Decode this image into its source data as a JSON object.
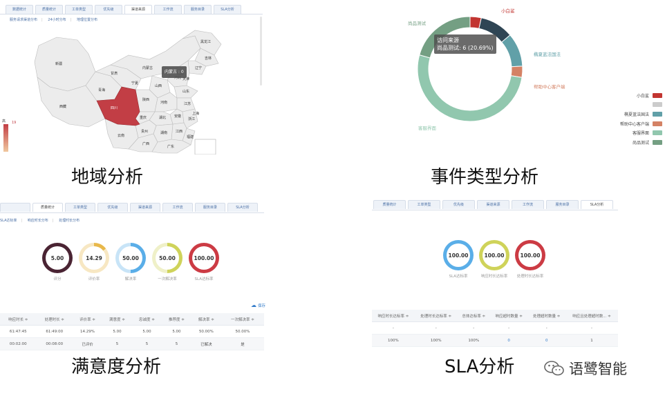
{
  "panel_region": {
    "tabs": [
      "数据统计",
      "质量统计",
      "工单类型",
      "优先级",
      "渠道来源",
      "工作流",
      "服务目录",
      "SLA分析"
    ],
    "active_tab": 4,
    "subnav": [
      "服务请求渠道分布",
      "24小时分布",
      "地理位置分布"
    ],
    "map_tooltip": "内蒙古 : 0",
    "legend_high": "高",
    "legend_high_value": "19",
    "provinces": [
      "新疆",
      "西藏",
      "青海",
      "甘肃",
      "四川",
      "内蒙古",
      "宁夏",
      "山西",
      "河北",
      "北京",
      "天津",
      "辽宁",
      "吉林",
      "黑龙江",
      "陕西",
      "河南",
      "山东",
      "江苏",
      "安徽",
      "湖北",
      "重庆",
      "贵州",
      "湖南",
      "江西",
      "浙江",
      "福建",
      "云南",
      "广西",
      "广东",
      "上海"
    ],
    "caption": "地域分析"
  },
  "panel_event": {
    "tooltip_title": "访问来源",
    "tooltip_value": "尚品测试: 6 (20.69%)",
    "chart_data": {
      "type": "pie",
      "donut": true,
      "series": [
        {
          "name": "小白鲨",
          "value": 1,
          "color": "#c23531"
        },
        {
          "name": "",
          "value": 3,
          "color": "#2f4554"
        },
        {
          "name": "椭夏蓝法国法",
          "value": 3,
          "color": "#61a0a8"
        },
        {
          "name": "帮助中心客户端",
          "value": 1,
          "color": "#d48265"
        },
        {
          "name": "客服界面",
          "value": 15,
          "color": "#91c7ae"
        },
        {
          "name": "尚品测试",
          "value": 6,
          "color": "#749f83"
        }
      ],
      "legend_position": "right"
    },
    "caption": "事件类型分析"
  },
  "panel_satisfaction": {
    "tabs": [
      "",
      "质量统计",
      "工单类型",
      "优先级",
      "渠道来源",
      "工作流",
      "服务目录",
      "SLA分析"
    ],
    "active_tab": 1,
    "subnav": [
      "SLA达标率",
      "响应时长分布",
      "处理时长分布"
    ],
    "rings": [
      {
        "value": "5.00",
        "label": "评分",
        "color": "#4a2433",
        "fill": 1.0
      },
      {
        "value": "14.29",
        "label": "评价率",
        "color": "#e8b84a",
        "fill": 0.1429
      },
      {
        "value": "50.00",
        "label": "解决率",
        "color": "#5aaee8",
        "fill": 0.5
      },
      {
        "value": "50.00",
        "label": "一次解决率",
        "color": "#cfd35a",
        "fill": 0.5
      },
      {
        "value": "100.00",
        "label": "SLA达标率",
        "color": "#cc3b44",
        "fill": 1.0
      }
    ],
    "save_label": "保存",
    "table": {
      "headers": [
        "响应时长 ≑",
        "处理时长 ≑",
        "评价率 ≑",
        "满意度 ≑",
        "忠诚度 ≑",
        "推荐度 ≑",
        "解决率 ≑",
        "一次解决率 ≑"
      ],
      "rows": [
        [
          "61:47:45",
          "61:49:00",
          "14.29%",
          "5.00",
          "5.00",
          "5.00",
          "50.00%",
          "50.00%"
        ],
        [
          "00:02:00",
          "00:08:00",
          "已评价",
          "5",
          "5",
          "5",
          "已解决",
          "是"
        ]
      ]
    },
    "caption": "满意度分析"
  },
  "panel_sla": {
    "tabs": [
      "质量统计",
      "工单类型",
      "优先级",
      "渠道来源",
      "工作流",
      "服务目录",
      "SLA分析"
    ],
    "active_tab": 6,
    "rings": [
      {
        "value": "100.00",
        "label": "SLA达标率",
        "color": "#5aaee8",
        "fill": 1.0
      },
      {
        "value": "100.00",
        "label": "响应时长达标率",
        "color": "#cfd35a",
        "fill": 1.0
      },
      {
        "value": "100.00",
        "label": "处理时长达标率",
        "color": "#cc3b44",
        "fill": 1.0
      }
    ],
    "table": {
      "headers": [
        "响应时长达标率 ≑",
        "处理时长达标率 ≑",
        "总体达标率 ≑",
        "响应超时数量 ≑",
        "处理超时数量 ≑",
        "响应且处理超时数... ≑"
      ],
      "rows": [
        [
          "-",
          "-",
          "-",
          "-",
          "-",
          "-"
        ],
        [
          "100%",
          "100%",
          "100%",
          "0",
          "0",
          "1"
        ]
      ]
    },
    "caption": "SLA分析"
  },
  "watermark": "语鹭智能"
}
